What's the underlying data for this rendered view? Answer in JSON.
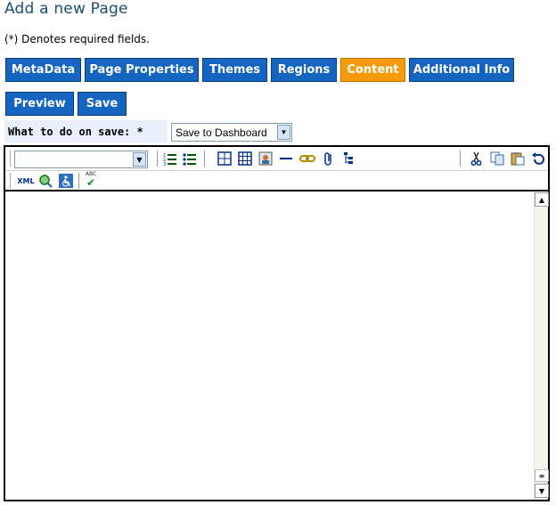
{
  "page": {
    "title": "Add a new Page",
    "required_note": "(*) Denotes required fields."
  },
  "tabs": [
    {
      "label": "MetaData",
      "active": false
    },
    {
      "label": "Page Properties",
      "active": false
    },
    {
      "label": "Themes",
      "active": false
    },
    {
      "label": "Regions",
      "active": false
    },
    {
      "label": "Content",
      "active": true
    },
    {
      "label": "Additional Info",
      "active": false
    }
  ],
  "actions": {
    "preview_label": "Preview",
    "save_label": "Save"
  },
  "save_options": {
    "label": "What to do on save: *",
    "selected": "Save to Dashboard"
  },
  "editor": {
    "format_value": "",
    "toolbar_icons": [
      "ordered-list-icon",
      "unordered-list-icon",
      "table-icon",
      "table-grid-icon",
      "image-icon",
      "horizontal-rule-icon",
      "link-icon",
      "attachment-icon",
      "tree-icon",
      "cut-icon",
      "copy-icon",
      "paste-icon",
      "undo-icon",
      "xml-icon",
      "zoom-icon",
      "accessibility-icon",
      "spellcheck-icon"
    ],
    "xml_label": "XML",
    "spell_label": "ABC"
  },
  "colors": {
    "tab_bg": "#1565c0",
    "tab_active_bg": "#f59b0b",
    "title_color": "#1b4f72"
  }
}
